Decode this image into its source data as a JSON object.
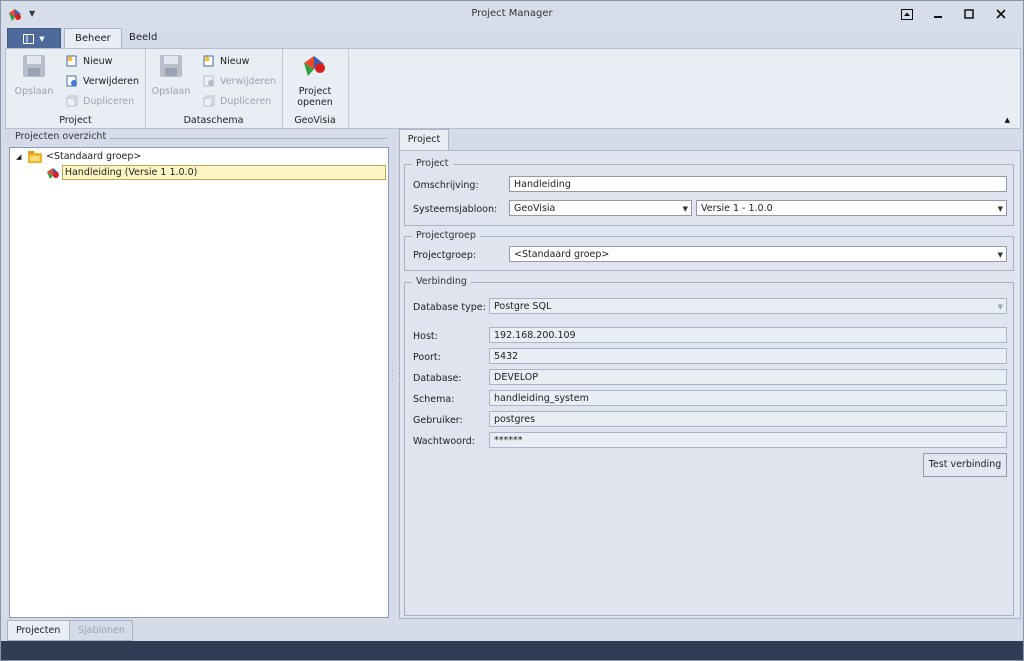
{
  "window": {
    "title": "Project Manager"
  },
  "ribbon": {
    "tabs": [
      {
        "label": "Beheer"
      },
      {
        "label": "Beeld"
      }
    ],
    "groups": {
      "project": {
        "label": "Project",
        "save_label": "Opslaan",
        "new_label": "Nieuw",
        "delete_label": "Verwijderen",
        "duplicate_label": "Dupliceren"
      },
      "dataschema": {
        "label": "Dataschema",
        "save_label": "Opslaan",
        "new_label": "Nieuw",
        "delete_label": "Verwijderen",
        "duplicate_label": "Dupliceren"
      },
      "geovisia": {
        "label": "GeoVisia",
        "open_label_line1": "Project",
        "open_label_line2": "openen"
      }
    }
  },
  "left_panel": {
    "caption": "Projecten overzicht",
    "tree": {
      "group_label": "<Standaard groep>",
      "item_label": "Handleiding (Versie 1 1.0.0)"
    }
  },
  "right_panel": {
    "tab_label": "Project",
    "project_group": {
      "legend": "Project",
      "description_label": "Omschrijving:",
      "description_value": "Handleiding",
      "template_label": "Systeemsjabloon:",
      "template_value": "GeoVisia",
      "version_value": "Versie 1 - 1.0.0"
    },
    "projectgroup_group": {
      "legend": "Projectgroep",
      "label": "Projectgroep:",
      "value": "<Standaard groep>"
    },
    "connection_group": {
      "legend": "Verbinding",
      "db_type_label": "Database type:",
      "db_type_value": "Postgre SQL",
      "host_label": "Host:",
      "host_value": "192.168.200.109",
      "port_label": "Poort:",
      "port_value": "5432",
      "database_label": "Database:",
      "database_value": "DEVELOP",
      "schema_label": "Schema:",
      "schema_value": "handleiding_system",
      "user_label": "Gebruiker:",
      "user_value": "postgres",
      "password_label": "Wachtwoord:",
      "password_value": "******",
      "test_button_label": "Test verbinding"
    }
  },
  "bottom_tabs": [
    {
      "label": "Projecten"
    },
    {
      "label": "Sjablonen"
    }
  ],
  "colors": {
    "background": "#d5dbe8",
    "ribbon": "#e9edf4",
    "app_button": "#4e6a9a",
    "status_bar": "#2f3c54",
    "selection": "#fdf6c3"
  }
}
